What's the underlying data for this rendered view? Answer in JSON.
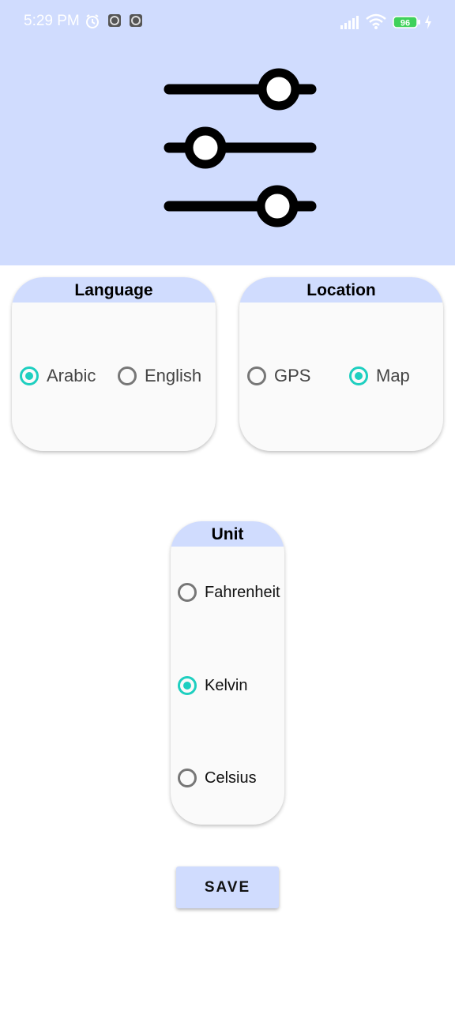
{
  "status_bar": {
    "time": "5:29 PM",
    "battery": "96",
    "icons": [
      "alarm-icon",
      "app-notification-icon",
      "app-notification-icon",
      "signal-icon",
      "wifi-icon",
      "battery-icon",
      "charging-icon"
    ]
  },
  "header": {
    "icon": "settings-sliders-icon",
    "background": "#d0dcfe"
  },
  "language_card": {
    "title": "Language",
    "options": [
      {
        "label": "Arabic",
        "selected": true
      },
      {
        "label": "English",
        "selected": false
      }
    ]
  },
  "location_card": {
    "title": "Location",
    "options": [
      {
        "label": "GPS",
        "selected": false
      },
      {
        "label": "Map",
        "selected": true
      }
    ]
  },
  "unit_card": {
    "title": "Unit",
    "options": [
      {
        "label": "Fahrenheit",
        "selected": false
      },
      {
        "label": "Kelvin",
        "selected": true
      },
      {
        "label": "Celsius",
        "selected": false
      }
    ]
  },
  "save_button": {
    "label": "SAVE"
  },
  "colors": {
    "accent": "#1ecfc0",
    "header": "#d0dcfe",
    "unselected": "#777777"
  }
}
